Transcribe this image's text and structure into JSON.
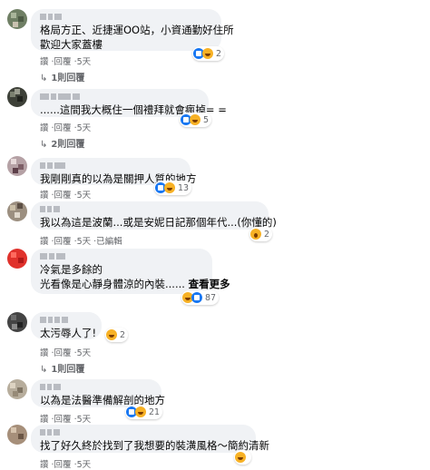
{
  "comments": [
    {
      "text_lines": [
        "格局方正、近捷運OO站，小資通勤好住所",
        "歡迎大家蓋樓"
      ],
      "actions": {
        "like": "讚",
        "reply": "回覆",
        "time": "5天"
      },
      "reactions": {
        "icons": [
          "like-icon",
          "haha-icon"
        ],
        "count": "2"
      },
      "replies_label": "1則回覆"
    },
    {
      "text_lines": [
        "......這間我大概住一個禮拜就會瘋掉= ="
      ],
      "actions": {
        "like": "讚",
        "reply": "回覆",
        "time": "5天"
      },
      "reactions": {
        "icons": [
          "like-icon",
          "haha-icon"
        ],
        "count": "5"
      },
      "replies_label": "2則回覆"
    },
    {
      "text_lines": [
        "我剛剛真的以為是關押人質的地方"
      ],
      "actions": {
        "like": "讚",
        "reply": "回覆",
        "time": "5天"
      },
      "reactions": {
        "icons": [
          "like-icon",
          "haha-icon"
        ],
        "count": "13"
      }
    },
    {
      "text_lines": [
        "我以為這是波蘭...或是安妮日記那個年代...(你懂的)"
      ],
      "actions": {
        "like": "讚",
        "reply": "回覆",
        "time": "5天",
        "edited": "已編輯"
      },
      "reactions": {
        "icons": [
          "wow-icon"
        ],
        "count": "2"
      }
    },
    {
      "text_lines": [
        "冷氣是多餘的",
        "光看像是心靜身體涼的內裝......"
      ],
      "see_more": "查看更多",
      "actions": {
        "like": "讚",
        "reply": "回覆",
        "time": "5天"
      },
      "reactions": {
        "icons": [
          "haha-icon",
          "like-icon"
        ],
        "count": "87"
      }
    },
    {
      "text_lines": [
        "太污辱人了!"
      ],
      "actions": {
        "like": "讚",
        "reply": "回覆",
        "time": "5天"
      },
      "reactions": {
        "icons": [
          "haha-icon"
        ],
        "count": "2"
      },
      "replies_label": "1則回覆"
    },
    {
      "text_lines": [
        "以為是法醫準備解剖的地方"
      ],
      "actions": {
        "like": "讚",
        "reply": "回覆",
        "time": "5天"
      },
      "reactions": {
        "icons": [
          "like-icon",
          "haha-icon"
        ],
        "count": "21"
      }
    },
    {
      "text_lines": [
        "找了好久終於找到了我想要的裝潢風格～簡約清新"
      ],
      "actions": {
        "like": "讚",
        "reply": "回覆",
        "time": "5天"
      },
      "reactions": {
        "icons": [
          "haha-icon"
        ],
        "count": ""
      }
    }
  ],
  "colors": {
    "bubble": "#f0f2f5",
    "secondary_text": "#65676b",
    "like_blue": "#1877f2",
    "emoji_yellow": "#f7b125"
  }
}
